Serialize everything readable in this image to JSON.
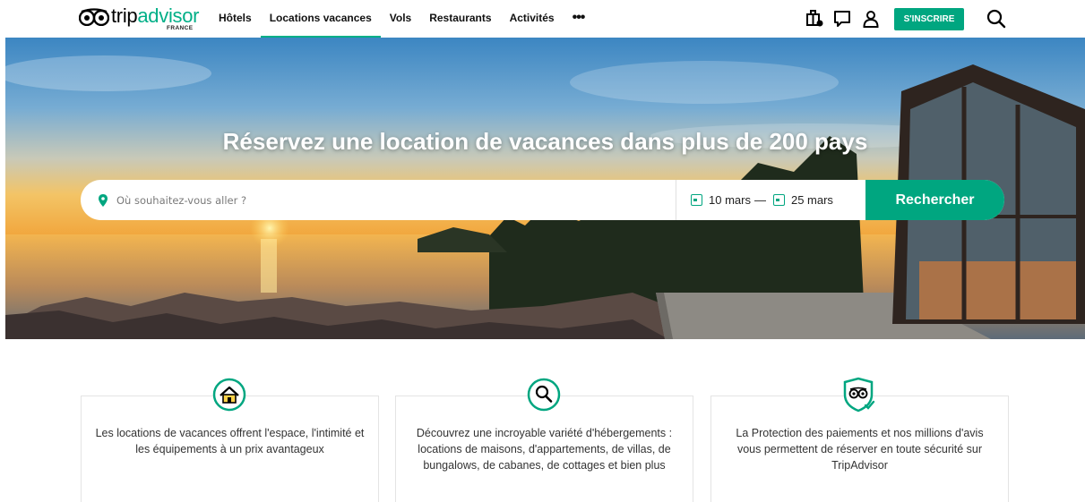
{
  "header": {
    "logo_trip": "trip",
    "logo_advisor": "advisor",
    "logo_sub": "FRANCE",
    "nav": [
      {
        "label": "Hôtels"
      },
      {
        "label": "Locations vacances",
        "active": true
      },
      {
        "label": "Vols"
      },
      {
        "label": "Restaurants"
      },
      {
        "label": "Activités"
      }
    ],
    "more_label": "•••",
    "signup_label": "S'INSCRIRE",
    "icons": [
      "trips-icon",
      "review-icon",
      "profile-icon",
      "search-icon"
    ]
  },
  "hero": {
    "title": "Réservez une location de vacances dans plus de 200 pays",
    "search": {
      "placeholder": "Où souhaitez-vous aller ?",
      "date_start": "10 mars",
      "date_sep": "—",
      "date_end": "25 mars",
      "button_label": "Rechercher"
    }
  },
  "features": [
    {
      "icon": "house-icon",
      "text": "Les locations de vacances offrent l'espace, l'intimité et les équipements à un prix avantageux"
    },
    {
      "icon": "magnifier-icon",
      "text": "Découvrez une incroyable variété d'hébergements : locations de maisons, d'appartements, de villas, de bungalows, de cabanes, de cottages et bien plus"
    },
    {
      "icon": "shield-owl-icon",
      "text": "La Protection des paiements et nos millions d'avis vous permettent de réserver en toute sécurité sur TripAdvisor"
    }
  ],
  "colors": {
    "brand_green": "#00a680",
    "logo_green": "#00af87"
  }
}
